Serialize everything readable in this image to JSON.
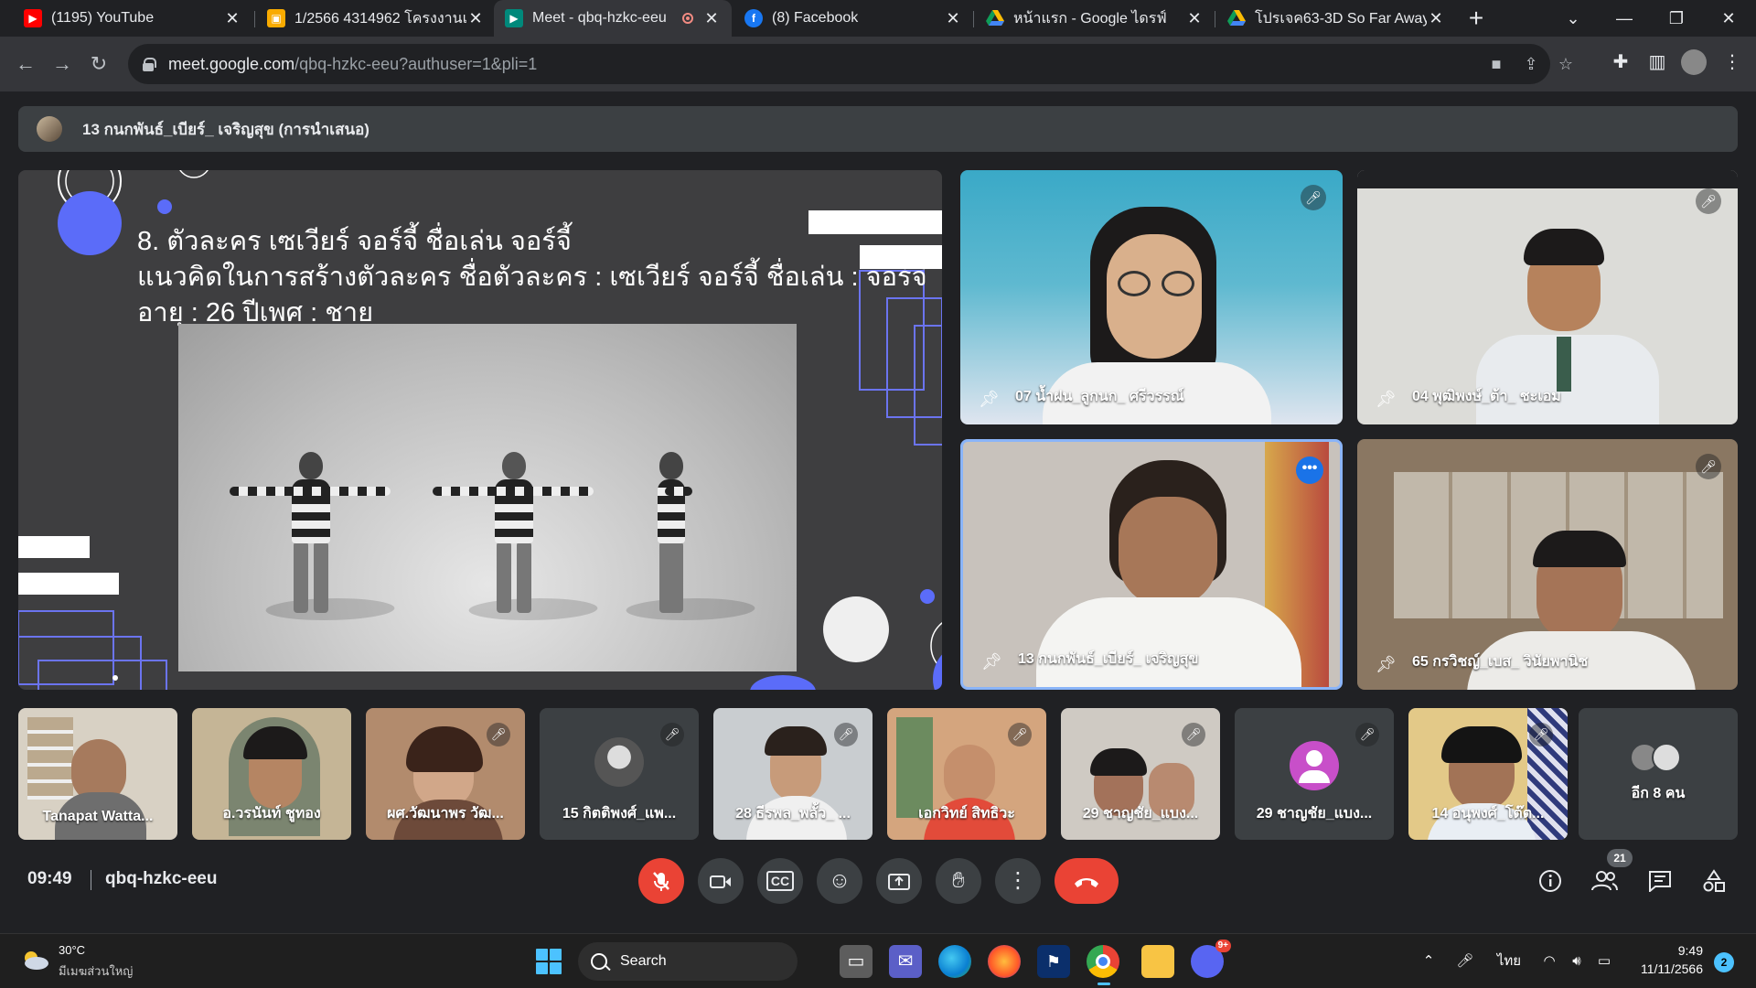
{
  "browser": {
    "tabs": [
      {
        "title": "(1195) YouTube",
        "favicon": "youtube-icon",
        "color": "#ff0000"
      },
      {
        "title": "1/2566 4314962 โครงงานแอ",
        "favicon": "google-classroom-icon",
        "color": "#f9ab00"
      },
      {
        "title": "Meet - qbq-hzkc-eeu",
        "favicon": "google-meet-icon",
        "color": "#00897b",
        "active": true
      },
      {
        "title": "(8) Facebook",
        "favicon": "facebook-icon",
        "color": "#1877f2"
      },
      {
        "title": "หน้าแรก - Google ไดรฟ์",
        "favicon": "google-drive-icon",
        "color": "#34a853"
      },
      {
        "title": "โปรเจค63-3D So Far Away -",
        "favicon": "google-drive-icon",
        "color": "#34a853"
      }
    ],
    "url_host": "meet.google.com",
    "url_path": "/qbq-hzkc-eeu?authuser=1&pli=1"
  },
  "meet": {
    "presenter_banner": "13 กนกพันธ์_เบียร์_ เจริญสุข (การนำเสนอ)",
    "slide": {
      "line1": "8. ตัวละคร เซเวียร์ จอร์จี้ ชื่อเล่น จอร์จี้",
      "line2": "แนวคิดในการสร้างตัวละคร ชื่อตัวละคร : เซเวียร์ จอร์จี้ ชื่อเล่น : จอร์จี้",
      "line3": "อายุ : 26 ปีเพศ : ชาย"
    },
    "tiles": [
      {
        "name": "07 น้ำฝน_ลูกนก_ ศรีวรรณ์",
        "muted": true
      },
      {
        "name": "04 พุฒิพงษ์_ต้า_ ชะเอม",
        "muted": true
      },
      {
        "name": "13 กนกพันธ์_เบียร์_ เจริญสุข",
        "muted": false
      },
      {
        "name": "65 กรวิชญ์_เบส_ วินัยพานิช",
        "muted": true
      }
    ],
    "thumbs": [
      {
        "name": "Tanapat Watta..."
      },
      {
        "name": "อ.วรนันท์ ชูทอง"
      },
      {
        "name": "ผศ.วัฒนาพร วัฒ..."
      },
      {
        "name": "15 กิตติพงศ์_แพ..."
      },
      {
        "name": "28 ธีรพล_พลั้ว_ ..."
      },
      {
        "name": "เอกวิทย์ สิทธิวะ"
      },
      {
        "name": "29 ชาญชัย_แบง..."
      },
      {
        "name": "29 ชาญชัย_แบง..."
      },
      {
        "name": "14 อนุพงศ์_โต๊ต..."
      }
    ],
    "more_label": "อีก 8 คน",
    "time": "09:49",
    "meeting_code": "qbq-hzkc-eeu",
    "participant_count": "21"
  },
  "taskbar": {
    "temperature": "30°C",
    "weather_desc": "มีเมฆส่วนใหญ่",
    "search_placeholder": "Search",
    "lang": "ไทย",
    "clock_time": "9:49",
    "clock_date": "11/11/2566",
    "notifications": "2",
    "discord_badge": "9+"
  }
}
